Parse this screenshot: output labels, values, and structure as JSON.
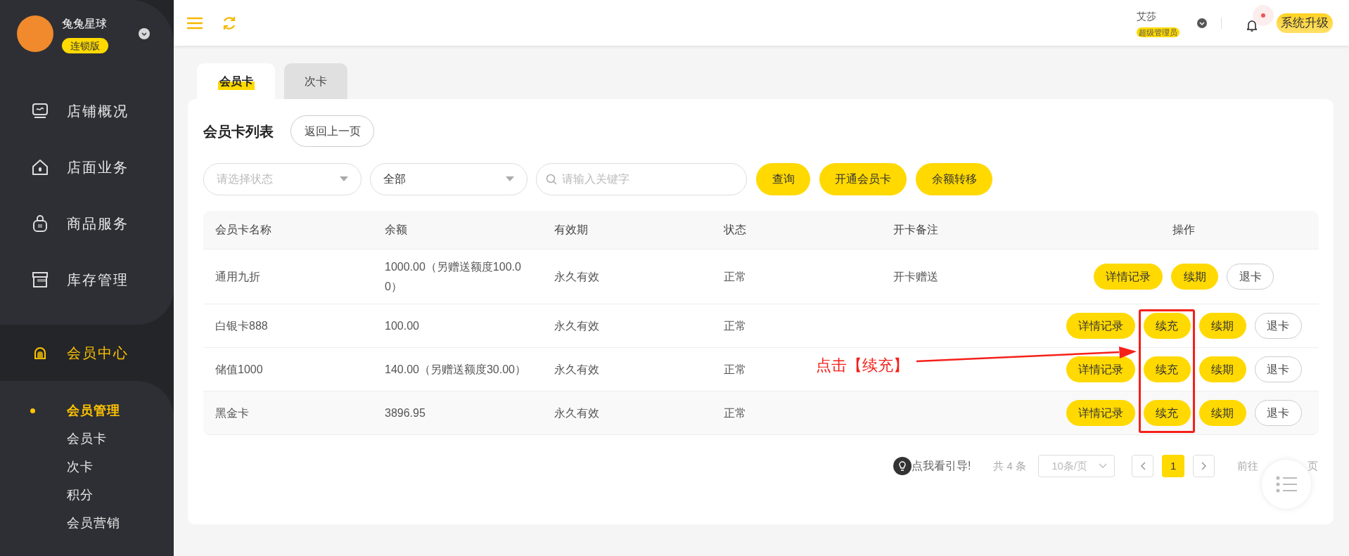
{
  "sidebar": {
    "brand": {
      "name": "兔兔星球",
      "edition": "连锁版"
    },
    "menu": [
      {
        "label": "店铺概况",
        "selected": false
      },
      {
        "label": "店面业务",
        "selected": false
      },
      {
        "label": "商品服务",
        "selected": false
      },
      {
        "label": "库存管理",
        "selected": false
      },
      {
        "label": "会员中心",
        "selected": true,
        "children": [
          {
            "label": "会员管理",
            "selected": true
          },
          {
            "label": "会员卡",
            "selected": false
          },
          {
            "label": "次卡",
            "selected": false
          },
          {
            "label": "积分",
            "selected": false
          },
          {
            "label": "会员营销",
            "selected": false
          }
        ]
      }
    ]
  },
  "header": {
    "user": {
      "name": "艾莎",
      "role": "超级管理员"
    },
    "notification_unread": true,
    "upgrade_button": "系统升级"
  },
  "tabs": [
    {
      "label": "会员卡",
      "selected": true
    },
    {
      "label": "次卡",
      "selected": false
    }
  ],
  "card": {
    "title": "会员卡列表",
    "back_button": "返回上一页",
    "filters": {
      "status_select": {
        "placeholder": "请选择状态"
      },
      "type_select": {
        "value": "全部"
      },
      "search": {
        "placeholder": "请输入关键字"
      }
    },
    "buttons": [
      "查询",
      "开通会员卡",
      "余额转移"
    ],
    "table": {
      "columns": [
        "会员卡名称",
        "余额",
        "有效期",
        "状态",
        "开卡备注",
        "操作"
      ],
      "rows": [
        {
          "highlighted": false,
          "cells": [
            "通用九折",
            "1000.00（另赠送额度100.00）",
            "永久有效",
            "正常",
            "开卡赠送"
          ],
          "actions": [
            {
              "label": "详情记录",
              "kind": "filled"
            },
            {
              "label": "续期",
              "kind": "filled"
            },
            {
              "label": "退卡",
              "kind": "outline"
            }
          ]
        },
        {
          "highlighted": false,
          "cells": [
            "白银卡888",
            "100.00",
            "永久有效",
            "正常",
            ""
          ],
          "actions": [
            {
              "label": "详情记录",
              "kind": "filled"
            },
            {
              "label": "续充",
              "kind": "filled"
            },
            {
              "label": "续期",
              "kind": "filled"
            },
            {
              "label": "退卡",
              "kind": "outline"
            }
          ]
        },
        {
          "highlighted": false,
          "cells": [
            "储值1000",
            "140.00（另赠送额度30.00）",
            "永久有效",
            "正常",
            ""
          ],
          "actions": [
            {
              "label": "详情记录",
              "kind": "filled"
            },
            {
              "label": "续充",
              "kind": "filled"
            },
            {
              "label": "续期",
              "kind": "filled"
            },
            {
              "label": "退卡",
              "kind": "outline"
            }
          ]
        },
        {
          "highlighted": true,
          "cells": [
            "黑金卡",
            "3896.95",
            "永久有效",
            "正常",
            ""
          ],
          "actions": [
            {
              "label": "详情记录",
              "kind": "filled"
            },
            {
              "label": "续充",
              "kind": "filled"
            },
            {
              "label": "续期",
              "kind": "filled"
            },
            {
              "label": "退卡",
              "kind": "outline"
            }
          ]
        }
      ]
    },
    "pagination": {
      "guide_link": "点我看引导!",
      "total": "共 4 条",
      "page_size": "10条/页",
      "pages": [
        {
          "label": "1",
          "selected": true
        }
      ],
      "goto_prefix": "前往",
      "goto_suffix": "页"
    }
  },
  "annotation": {
    "text": "点击【续充】"
  }
}
